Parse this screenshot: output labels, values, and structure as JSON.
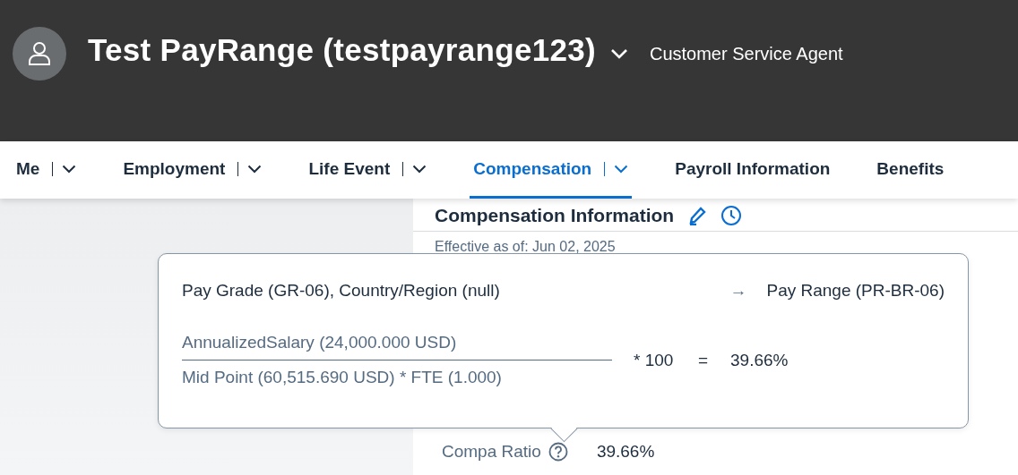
{
  "header": {
    "name": "Test PayRange (testpayrange123)",
    "job_title": "Customer Service Agent"
  },
  "tabs": [
    {
      "label": "Me",
      "menu": true,
      "selected": false
    },
    {
      "label": "Employment",
      "menu": true,
      "selected": false
    },
    {
      "label": "Life Event",
      "menu": true,
      "selected": false
    },
    {
      "label": "Compensation",
      "menu": true,
      "selected": true
    },
    {
      "label": "Payroll Information",
      "menu": false,
      "selected": false
    },
    {
      "label": "Benefits",
      "menu": false,
      "selected": false
    }
  ],
  "section": {
    "title": "Compensation Information",
    "effective": "Effective as of:  Jun 02, 2025"
  },
  "popover": {
    "source": "Pay Grade (GR-06), Country/Region (null)",
    "arrow": "→",
    "target": "Pay Range (PR-BR-06)",
    "numerator": "AnnualizedSalary (24,000.000 USD)",
    "denominator": "Mid Point (60,515.690 USD) * FTE (1.000)",
    "multiplier": "* 100",
    "equals": "=",
    "result": "39.66%"
  },
  "field": {
    "label": "Compa Ratio",
    "value": "39.66%"
  }
}
